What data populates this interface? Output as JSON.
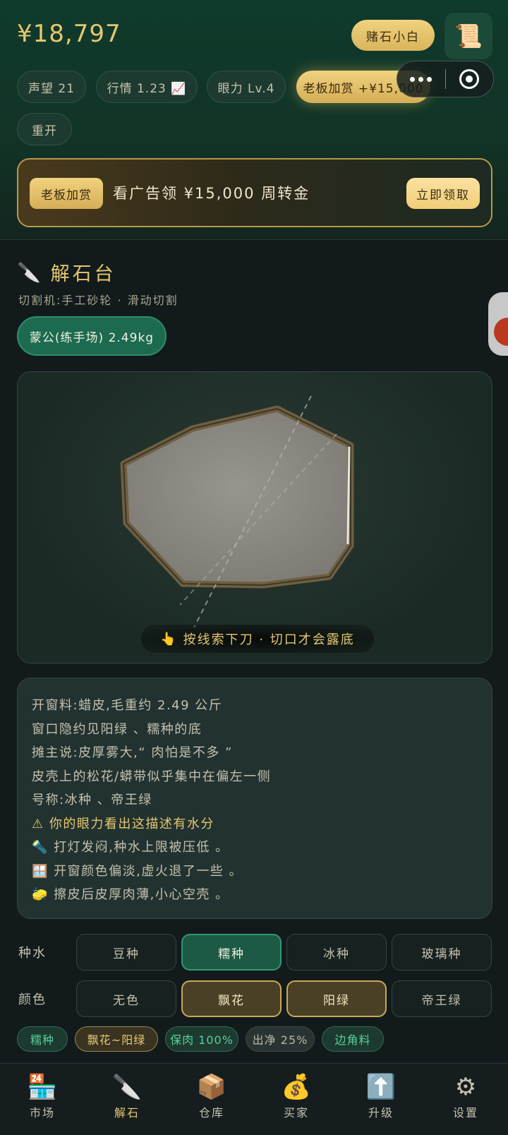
{
  "header": {
    "money": "¥18,797",
    "rank_badge": "赌石小白",
    "scroll_icon": "📜",
    "chips": [
      {
        "label": "声望 21"
      },
      {
        "label": "行情 1.23 📈"
      },
      {
        "label": "眼力 Lv.4"
      },
      {
        "label": "老板加赏 +¥15,000"
      },
      {
        "label": "重开"
      }
    ]
  },
  "ad_banner": {
    "tag": "老板加赏",
    "text": "看广告领 ¥15,000 周转金",
    "button": "立即领取"
  },
  "workbench": {
    "icon": "🔪",
    "title": "解石台",
    "subtitle": "切割机:手工砂轮 · 滑动切割",
    "stone_tag": "蒙公(练手场) 2.49kg",
    "hint_icon": "👆",
    "hint": "按线索下刀 · 切口才会露底"
  },
  "description": {
    "lines": [
      "开窗料:蜡皮,毛重约 2.49 公斤",
      "窗口隐约见阳绿 、糯种的底",
      "摊主说:皮厚雾大,“ 肉怕是不多 ”",
      "皮壳上的松花/蟒带似乎集中在偏左一侧",
      "号称:冰种 、帝王绿",
      "⚠ 你的眼力看出这描述有水分",
      "🔦 打灯发闷,种水上限被压低 。",
      "🪟 开窗颜色偏淡,虚火退了一些 。",
      "🧽 擦皮后皮厚肉薄,小心空壳 。"
    ]
  },
  "guess": {
    "water_label": "种水",
    "water_options": [
      "豆种",
      "糯种",
      "冰种",
      "玻璃种"
    ],
    "water_selected": "糯种",
    "color_label": "颜色",
    "color_options": [
      "无色",
      "飘花",
      "阳绿",
      "帝王绿"
    ],
    "color_selected": [
      "飘花",
      "阳绿"
    ]
  },
  "result_pills": [
    "糯种",
    "飘花~阳绿",
    "保肉 100%",
    "出净 25%",
    "边角料"
  ],
  "tabbar": [
    {
      "icon": "🏪",
      "label": "市场"
    },
    {
      "icon": "🔪",
      "label": "解石"
    },
    {
      "icon": "📦",
      "label": "仓库"
    },
    {
      "icon": "💰",
      "label": "买家"
    },
    {
      "icon": "⬆️",
      "label": "升级"
    },
    {
      "icon": "⚙",
      "label": "设置"
    }
  ],
  "active_tab": "解石",
  "colors": {
    "accent_gold": "#e6c76f",
    "accent_green": "#2e9a74",
    "background": "#121a1c"
  }
}
